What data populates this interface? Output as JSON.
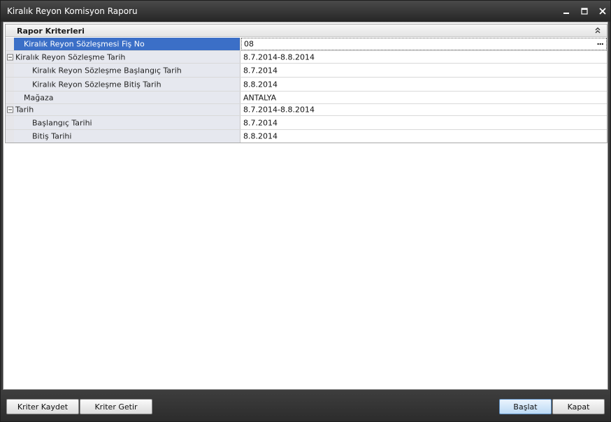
{
  "window": {
    "title": "Kiralık Reyon Komisyon Raporu",
    "controls": {
      "minimize": "▁",
      "maximize": "▭",
      "close": "✕"
    }
  },
  "criteria": {
    "category": "Rapor Kriterleri",
    "collapse_icon": "chevron-double-up",
    "rows": [
      {
        "label": "Kiralık Reyon Sözleşmesi Fiş No",
        "value": "08"
      },
      {
        "label": "Kiralık Reyon Sözleşme Tarih",
        "value": "8.7.2014-8.8.2014"
      },
      {
        "label": "Kiralık Reyon Sözleşme Başlangıç Tarih",
        "value": "8.7.2014"
      },
      {
        "label": "Kiralık Reyon Sözleşme Bitiş Tarih",
        "value": "8.8.2014"
      },
      {
        "label": "Mağaza",
        "value": "ANTALYA"
      },
      {
        "label": "Tarih",
        "value": "8.7.2014-8.8.2014"
      },
      {
        "label": "Başlangıç Tarihi",
        "value": "8.7.2014"
      },
      {
        "label": "Bitiş Tarihi",
        "value": "8.8.2014"
      }
    ],
    "ellipsis": "···"
  },
  "footer": {
    "save_label": "Kriter Kaydet",
    "load_label": "Kriter Getir",
    "start_label": "Başlat",
    "close_label": "Kapat"
  },
  "colors": {
    "selected_row": "#3b6fc7",
    "property_name_bg": "#e6e8ef",
    "frame": "#3a3a3a"
  }
}
